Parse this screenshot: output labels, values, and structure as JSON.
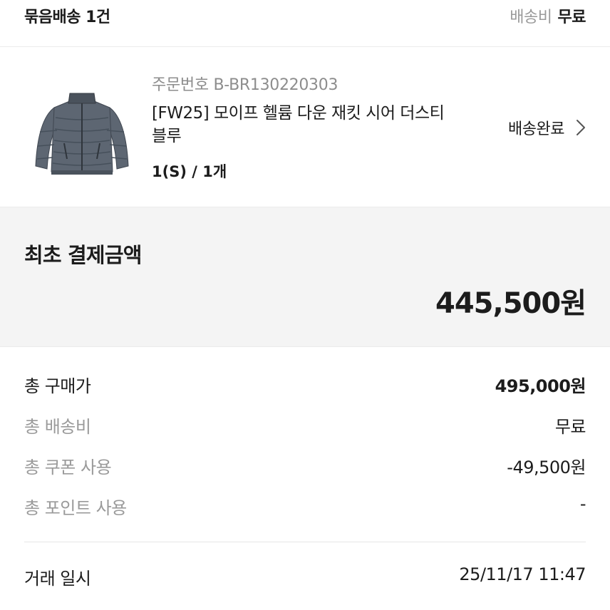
{
  "bundle": {
    "title": "묶음배송 1건",
    "shipping_label": "배송비",
    "shipping_value": "무료"
  },
  "product": {
    "order_number": "주문번호 B-BR130220303",
    "name": "[FW25] 모이프 헬륨 다운 재킷 시어 더스티 블루",
    "option": "1(S) / 1개",
    "status": "배송완료",
    "thumbnail_icon": "puffer-jacket-image"
  },
  "first_payment": {
    "label": "최초 결제금액",
    "amount": "445,500원"
  },
  "summary": {
    "rows": [
      {
        "label": "총 구매가",
        "value": "495,000원"
      },
      {
        "label": "총 배송비",
        "value": "무료"
      },
      {
        "label": "총 쿠폰 사용",
        "value": "-49,500원"
      },
      {
        "label": "총 포인트 사용",
        "value": "-"
      }
    ]
  },
  "transaction": {
    "label": "거래 일시",
    "value": "25/11/17 11:47"
  },
  "colors": {
    "muted_text": "#9a9a9a",
    "section_bg": "#f4f4f4",
    "jacket": "#5b6470"
  }
}
